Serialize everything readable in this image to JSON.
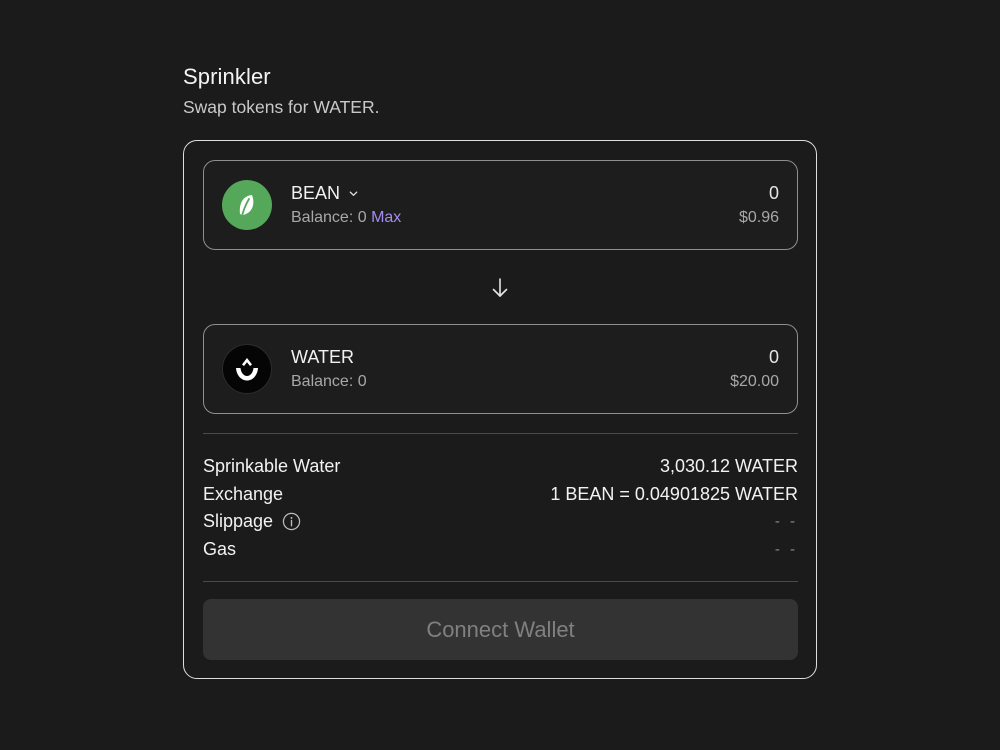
{
  "header": {
    "title": "Sprinkler",
    "subtitle": "Swap tokens for WATER."
  },
  "from_token": {
    "symbol": "BEAN",
    "icon": "bean-leaf-icon",
    "balance_label": "Balance: 0",
    "max_label": "Max",
    "amount": "0",
    "usd_value": "$0.96",
    "logo_color": "#55a85a"
  },
  "swap_direction_icon": "arrow-down-icon",
  "to_token": {
    "symbol": "WATER",
    "icon": "water-drop-icon",
    "balance_label": "Balance: 0",
    "amount": "0",
    "usd_value": "$20.00"
  },
  "details": [
    {
      "label": "Sprinkable Water",
      "value": "3,030.12 WATER"
    },
    {
      "label": "Exchange",
      "value": "1 BEAN = 0.04901825 WATER"
    },
    {
      "label": "Slippage",
      "value": "- -",
      "info_icon": "info-icon"
    },
    {
      "label": "Gas",
      "value": "- -"
    }
  ],
  "action": {
    "connect_label": "Connect Wallet"
  },
  "colors": {
    "background": "#1b1b1b",
    "accent": "#a58bf0",
    "button_bg": "#333333"
  }
}
